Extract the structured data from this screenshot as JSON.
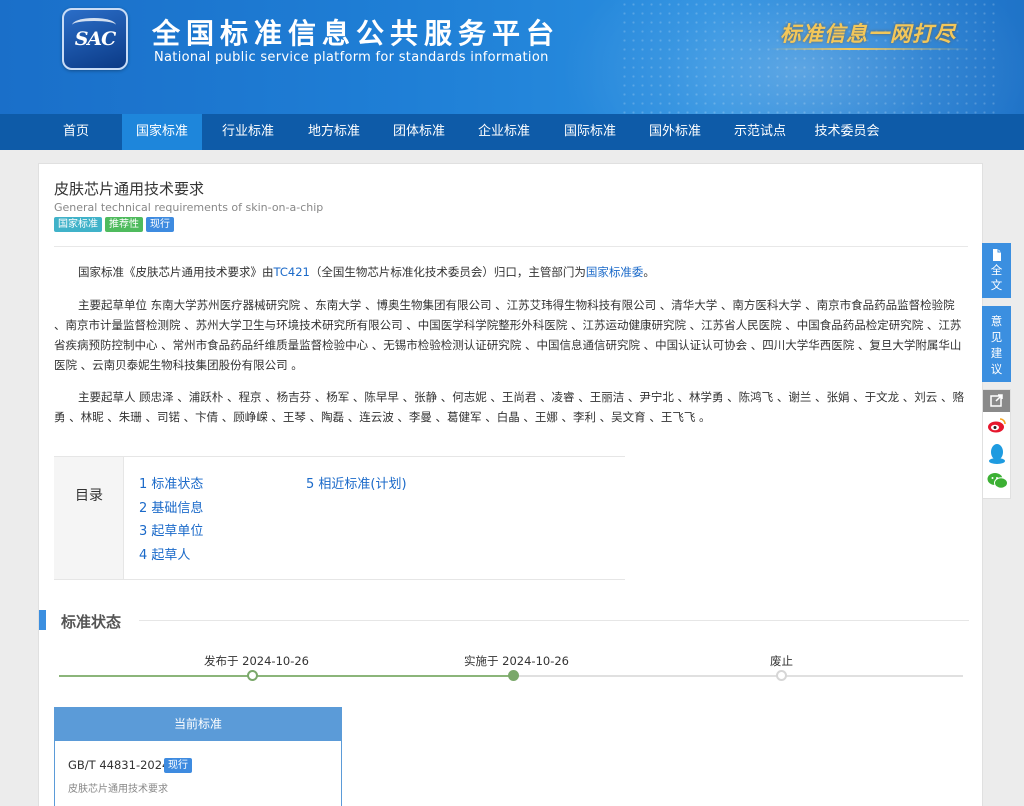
{
  "header": {
    "logo_text": "SAC",
    "title_cn": "全国标准信息公共服务平台",
    "title_en": "National public service platform  for standards information",
    "slogan": "标准信息一网打尽"
  },
  "nav": {
    "items": [
      "首页",
      "国家标准",
      "行业标准",
      "地方标准",
      "团体标准",
      "企业标准",
      "国际标准",
      "国外标准",
      "示范试点",
      "技术委员会"
    ],
    "active_index": 1
  },
  "standard": {
    "title": "皮肤芯片通用技术要求",
    "title_en": "General technical requirements of skin-on-a-chip",
    "badges": [
      "国家标准",
      "推荐性",
      "现行"
    ],
    "intro": {
      "prefix": "国家标准《皮肤芯片通用技术要求》由",
      "tc_link": "TC421",
      "middle": "（全国生物芯片标准化技术委员会）归口，主管部门为",
      "dept_link": "国家标准委",
      "suffix": "。"
    },
    "drafting_units": "主要起草单位 东南大学苏州医疗器械研究院 、东南大学 、博奥生物集团有限公司 、江苏艾玮得生物科技有限公司 、清华大学 、南方医科大学 、南京市食品药品监督检验院 、南京市计量监督检测院 、苏州大学卫生与环境技术研究所有限公司 、中国医学科学院整形外科医院 、江苏运动健康研究院 、江苏省人民医院 、中国食品药品检定研究院 、江苏省疾病预防控制中心 、常州市食品药品纤维质量监督检验中心 、无锡市检验检测认证研究院 、中国信息通信研究院 、中国认证认可协会 、四川大学华西医院 、复旦大学附属华山医院 、云南贝泰妮生物科技集团股份有限公司 。",
    "drafters": "主要起草人 顾忠泽 、浦跃朴 、程京 、杨吉芬 、杨军 、陈早早 、张静 、何志妮 、王尚君 、凌睿 、王丽洁 、尹宁北 、林学勇 、陈鸿飞 、谢兰 、张娟 、于文龙 、刘云 、赂勇 、林昵 、朱珊 、司锘 、卞倩 、顾峥嵘 、王琴 、陶磊 、连云波 、李曼 、葛健军 、白晶 、王娜 、李利 、吴文育 、王飞飞 。"
  },
  "toc": {
    "label": "目录",
    "items": [
      "1  标准状态",
      "2  基础信息",
      "3  起草单位",
      "4  起草人",
      "5  相近标准(计划)"
    ]
  },
  "status": {
    "section_title": "标准状态",
    "timeline": [
      "发布于 2024-10-26",
      "实施于 2024-10-26",
      "废止"
    ],
    "current_header": "当前标准",
    "current_code": "GB/T 44831-2024",
    "current_badge": "现行",
    "current_name": "皮肤芯片通用技术要求"
  },
  "sidebar": {
    "fulltext": "全文",
    "feedback": "意见建议"
  },
  "colors": {
    "header_blue": "#1f7fd6",
    "nav_blue": "#0e5ba8",
    "nav_active": "#1e86db",
    "link": "#1b6ac9",
    "accent": "#3b8fe0"
  }
}
